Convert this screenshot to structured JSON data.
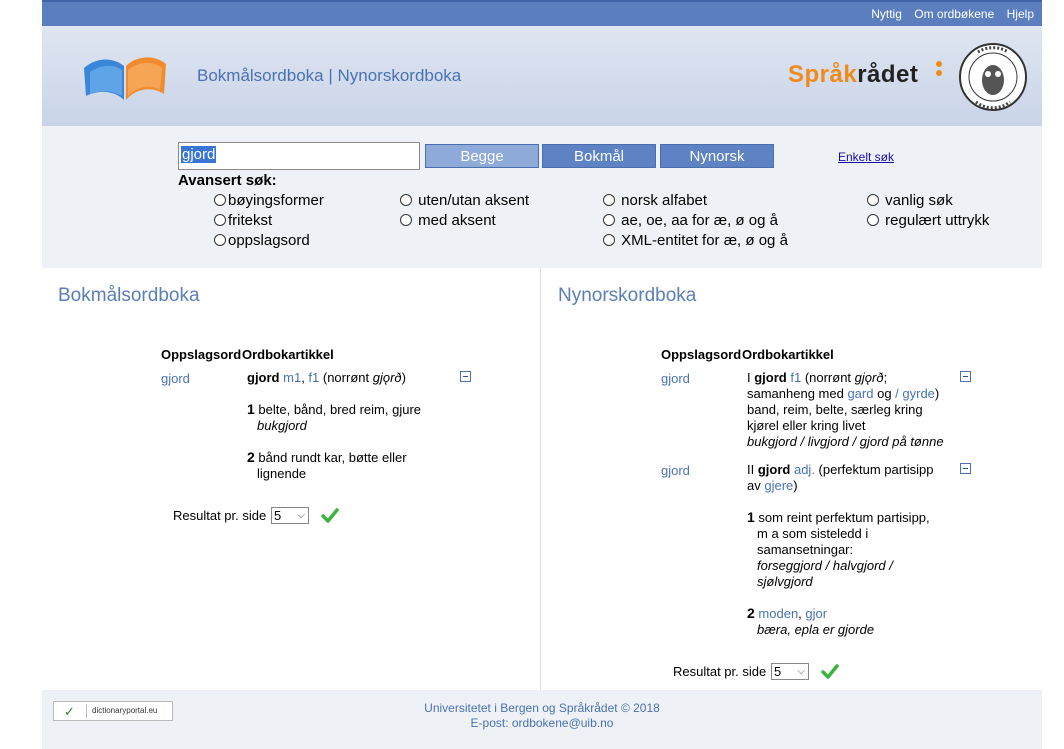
{
  "topnav": {
    "items": [
      "Nyttig",
      "Om ordbøkene",
      "Hjelp"
    ]
  },
  "header": {
    "site_title": "Bokmålsordboka | Nynorskordboka",
    "brand_part1": "Språk",
    "brand_part2": "rådet",
    "brand_color": "#f08a1c"
  },
  "search": {
    "query": "gjord",
    "buttons": {
      "both": "Begge",
      "bokmal": "Bokmål",
      "nynorsk": "Nynorsk"
    },
    "simple_search_link": "Enkelt søk",
    "advanced_title": "Avansert søk:",
    "options": {
      "boyingsformer": "bøyingsformer",
      "fritekst": "fritekst",
      "oppslagsord": "oppslagsord",
      "uten_aksent": "uten/utan aksent",
      "med_aksent": "med aksent",
      "norsk_alfabet": "norsk alfabet",
      "ae_oe_aa": "ae, oe, aa for æ, ø og å",
      "xml_entitet": "XML-entitet for æ, ø og å",
      "vanlig_sok": "vanlig søk",
      "regulaert": "regulært uttrykk"
    }
  },
  "bokmal": {
    "title": "Bokmålsordboka",
    "col_lemma": "Oppslagsord",
    "col_article": "Ordbokartikkel",
    "entry": {
      "lemma": "gjord",
      "headword": "gjord",
      "gram1": "m1",
      "sep": ", ",
      "gram2": "f1",
      "etym_open": " (norrønt ",
      "etym_word": "gjǫrð",
      "etym_close": ")",
      "sense1_num": "1",
      "sense1_text": " belte, bånd, bred reim, gjure",
      "sense1_example": "bukgjord",
      "sense2_num": "2",
      "sense2_text": " bånd rundt kar, bøtte eller",
      "sense2_text_cont": "lignende"
    },
    "results_label": "Resultat pr. side",
    "results_value": "5"
  },
  "nynorsk": {
    "title": "Nynorskordboka",
    "col_lemma": "Oppslagsord",
    "col_article": "Ordbokartikkel",
    "entry1": {
      "lemma": "gjord",
      "roman": "I ",
      "headword": "gjord",
      "gram": "f1",
      "etym_open": " (norrønt ",
      "etym_word": "gjǫrð",
      "etym_close": ";",
      "line2_a": "samanheng  med ",
      "link_gard": "gard",
      "line2_og": " og ",
      "link_gyrde": "/ gyrde",
      "line2_close": ")",
      "line3": "band, reim, belte, særleg kring",
      "line4": "kjørel eller kring livet",
      "example": "bukgjord / livgjord / gjord på tønne"
    },
    "entry2": {
      "lemma": "gjord",
      "roman": "II ",
      "headword": "gjord",
      "gram": "adj.",
      "desc": " (perfektum partisipp",
      "av": "av ",
      "link_gjere": "gjere",
      "close": ")",
      "sense1_num": "1",
      "sense1_l1": " som reint perfektum partisipp,",
      "sense1_l2": "m a som sisteledd i",
      "sense1_l3": "samansetningar:",
      "sense1_ex1": "forseggjord / halvgjord /",
      "sense1_ex2": "sjølvgjord",
      "sense2_num": "2",
      "link_moden": "moden",
      "sense2_sep": ", ",
      "link_gjor": "gjor",
      "sense2_ex": "bæra, epla er gjorde"
    },
    "results_label": "Resultat pr. side",
    "results_value": "5"
  },
  "footer": {
    "line1": "Universitetet i Bergen og Språkrådet © 2018",
    "line2": "E-post: ordbokene@uib.no",
    "badge_text": "dictionaryportal.eu"
  }
}
